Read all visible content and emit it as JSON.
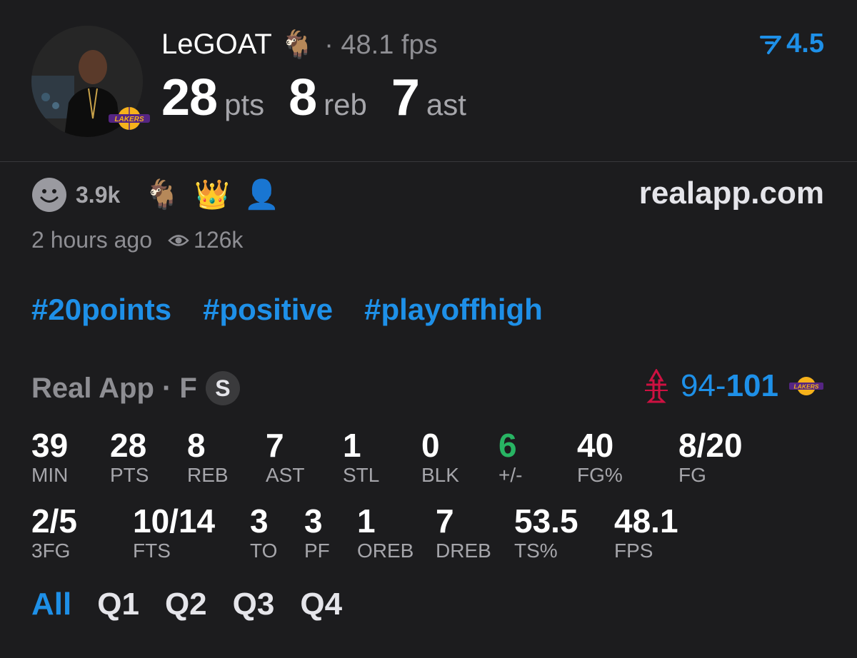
{
  "player": {
    "name": "LeGOAT",
    "name_emoji": "🐐",
    "fps_text": "· 48.1 fps",
    "points": "28",
    "points_unit": "pts",
    "rebounds": "8",
    "rebounds_unit": "reb",
    "assists": "7",
    "assists_unit": "ast"
  },
  "line": {
    "value": "4.5",
    "icon": "prediction-line-icon"
  },
  "reactions": {
    "count": "3.9k",
    "emojis": [
      "🐐",
      "👑",
      "👤"
    ],
    "time_ago": "2 hours ago",
    "views": "126k"
  },
  "site": "realapp.com",
  "hashtags": [
    "#20points",
    "#positive",
    "#playoffhigh"
  ],
  "game": {
    "source": "Real App · F",
    "badge": "S",
    "away_score": "94",
    "separator": "-",
    "home_score": "101"
  },
  "stats": {
    "row1": [
      {
        "value": "39",
        "label": "MIN"
      },
      {
        "value": "28",
        "label": "PTS"
      },
      {
        "value": "8",
        "label": "REB"
      },
      {
        "value": "7",
        "label": "AST"
      },
      {
        "value": "1",
        "label": "STL"
      },
      {
        "value": "0",
        "label": "BLK"
      },
      {
        "value": "6",
        "label": "+/-"
      },
      {
        "value": "40",
        "label": "FG%"
      },
      {
        "value": "8/20",
        "label": "FG"
      }
    ],
    "row2": [
      {
        "value": "2/5",
        "label": "3FG"
      },
      {
        "value": "10/14",
        "label": "FTS"
      },
      {
        "value": "3",
        "label": "TO"
      },
      {
        "value": "3",
        "label": "PF"
      },
      {
        "value": "1",
        "label": "OREB"
      },
      {
        "value": "7",
        "label": "DREB"
      },
      {
        "value": "53.5",
        "label": "TS%"
      },
      {
        "value": "48.1",
        "label": "FPS"
      }
    ]
  },
  "tabs": [
    "All",
    "Q1",
    "Q2",
    "Q3",
    "Q4"
  ],
  "colors": {
    "accent": "#1e90e8",
    "positive": "#28b463",
    "background": "#1c1c1e"
  }
}
